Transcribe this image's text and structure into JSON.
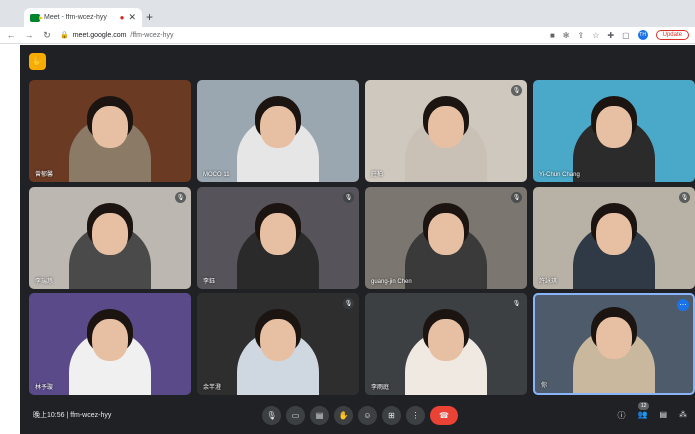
{
  "browser": {
    "tab_title": "Meet - ffm-wcez-hyy",
    "tab_record_icon": "record-icon",
    "new_tab_label": "+",
    "url_host": "meet.google.com",
    "url_path": "/ffm-wcez-hyy",
    "profile_initials": "TH",
    "update_label": "Update"
  },
  "meet": {
    "meeting_code": "ffm-wcez-hyy",
    "time": "晚上10:56",
    "participant_count": "12",
    "tiles": [
      {
        "name": "曾郁馨",
        "bg": "#6b3a22",
        "shirt": "#8a7a66",
        "muted": false
      },
      {
        "name": "MOCO 11",
        "bg": "#9aa7b0",
        "shirt": "#e6e6e6",
        "muted": false
      },
      {
        "name": "莊柏",
        "bg": "#cfc8be",
        "shirt": "#c9c1b6",
        "muted": true
      },
      {
        "name": "Yi-Chun Chang",
        "bg": "#4aa8c8",
        "shirt": "#2b2b2b",
        "muted": false
      },
      {
        "name": "李瑞慈",
        "bg": "#bdb7b2",
        "shirt": "#4a4a4a",
        "muted": true
      },
      {
        "name": "李鈺",
        "bg": "#56545a",
        "shirt": "#2a2a2a",
        "muted": true
      },
      {
        "name": "guang-jin Chen",
        "bg": "#7b7670",
        "shirt": "#3a3a3a",
        "muted": true
      },
      {
        "name": "許詠琪",
        "bg": "#b8b1a6",
        "shirt": "#2f3a46",
        "muted": true
      },
      {
        "name": "林予璇",
        "bg": "#5b4a8a",
        "shirt": "#f0f0f0",
        "muted": false
      },
      {
        "name": "余芊澄",
        "bg": "#2e2e2e",
        "shirt": "#cfd8e0",
        "muted": true
      },
      {
        "name": "李雨庭",
        "bg": "#3c4043",
        "shirt": "#efe9e2",
        "muted": true
      },
      {
        "name": "你",
        "bg": "#4e5b6a",
        "shirt": "#c9b89e",
        "muted": false
      }
    ],
    "controls": [
      "mic-icon",
      "camera-icon",
      "captions-icon",
      "raise-hand-icon",
      "emoji-icon",
      "present-icon",
      "more-options-icon",
      "end-call-icon"
    ],
    "right_icons": [
      "info-icon",
      "people-icon",
      "chat-icon",
      "activities-icon"
    ]
  }
}
